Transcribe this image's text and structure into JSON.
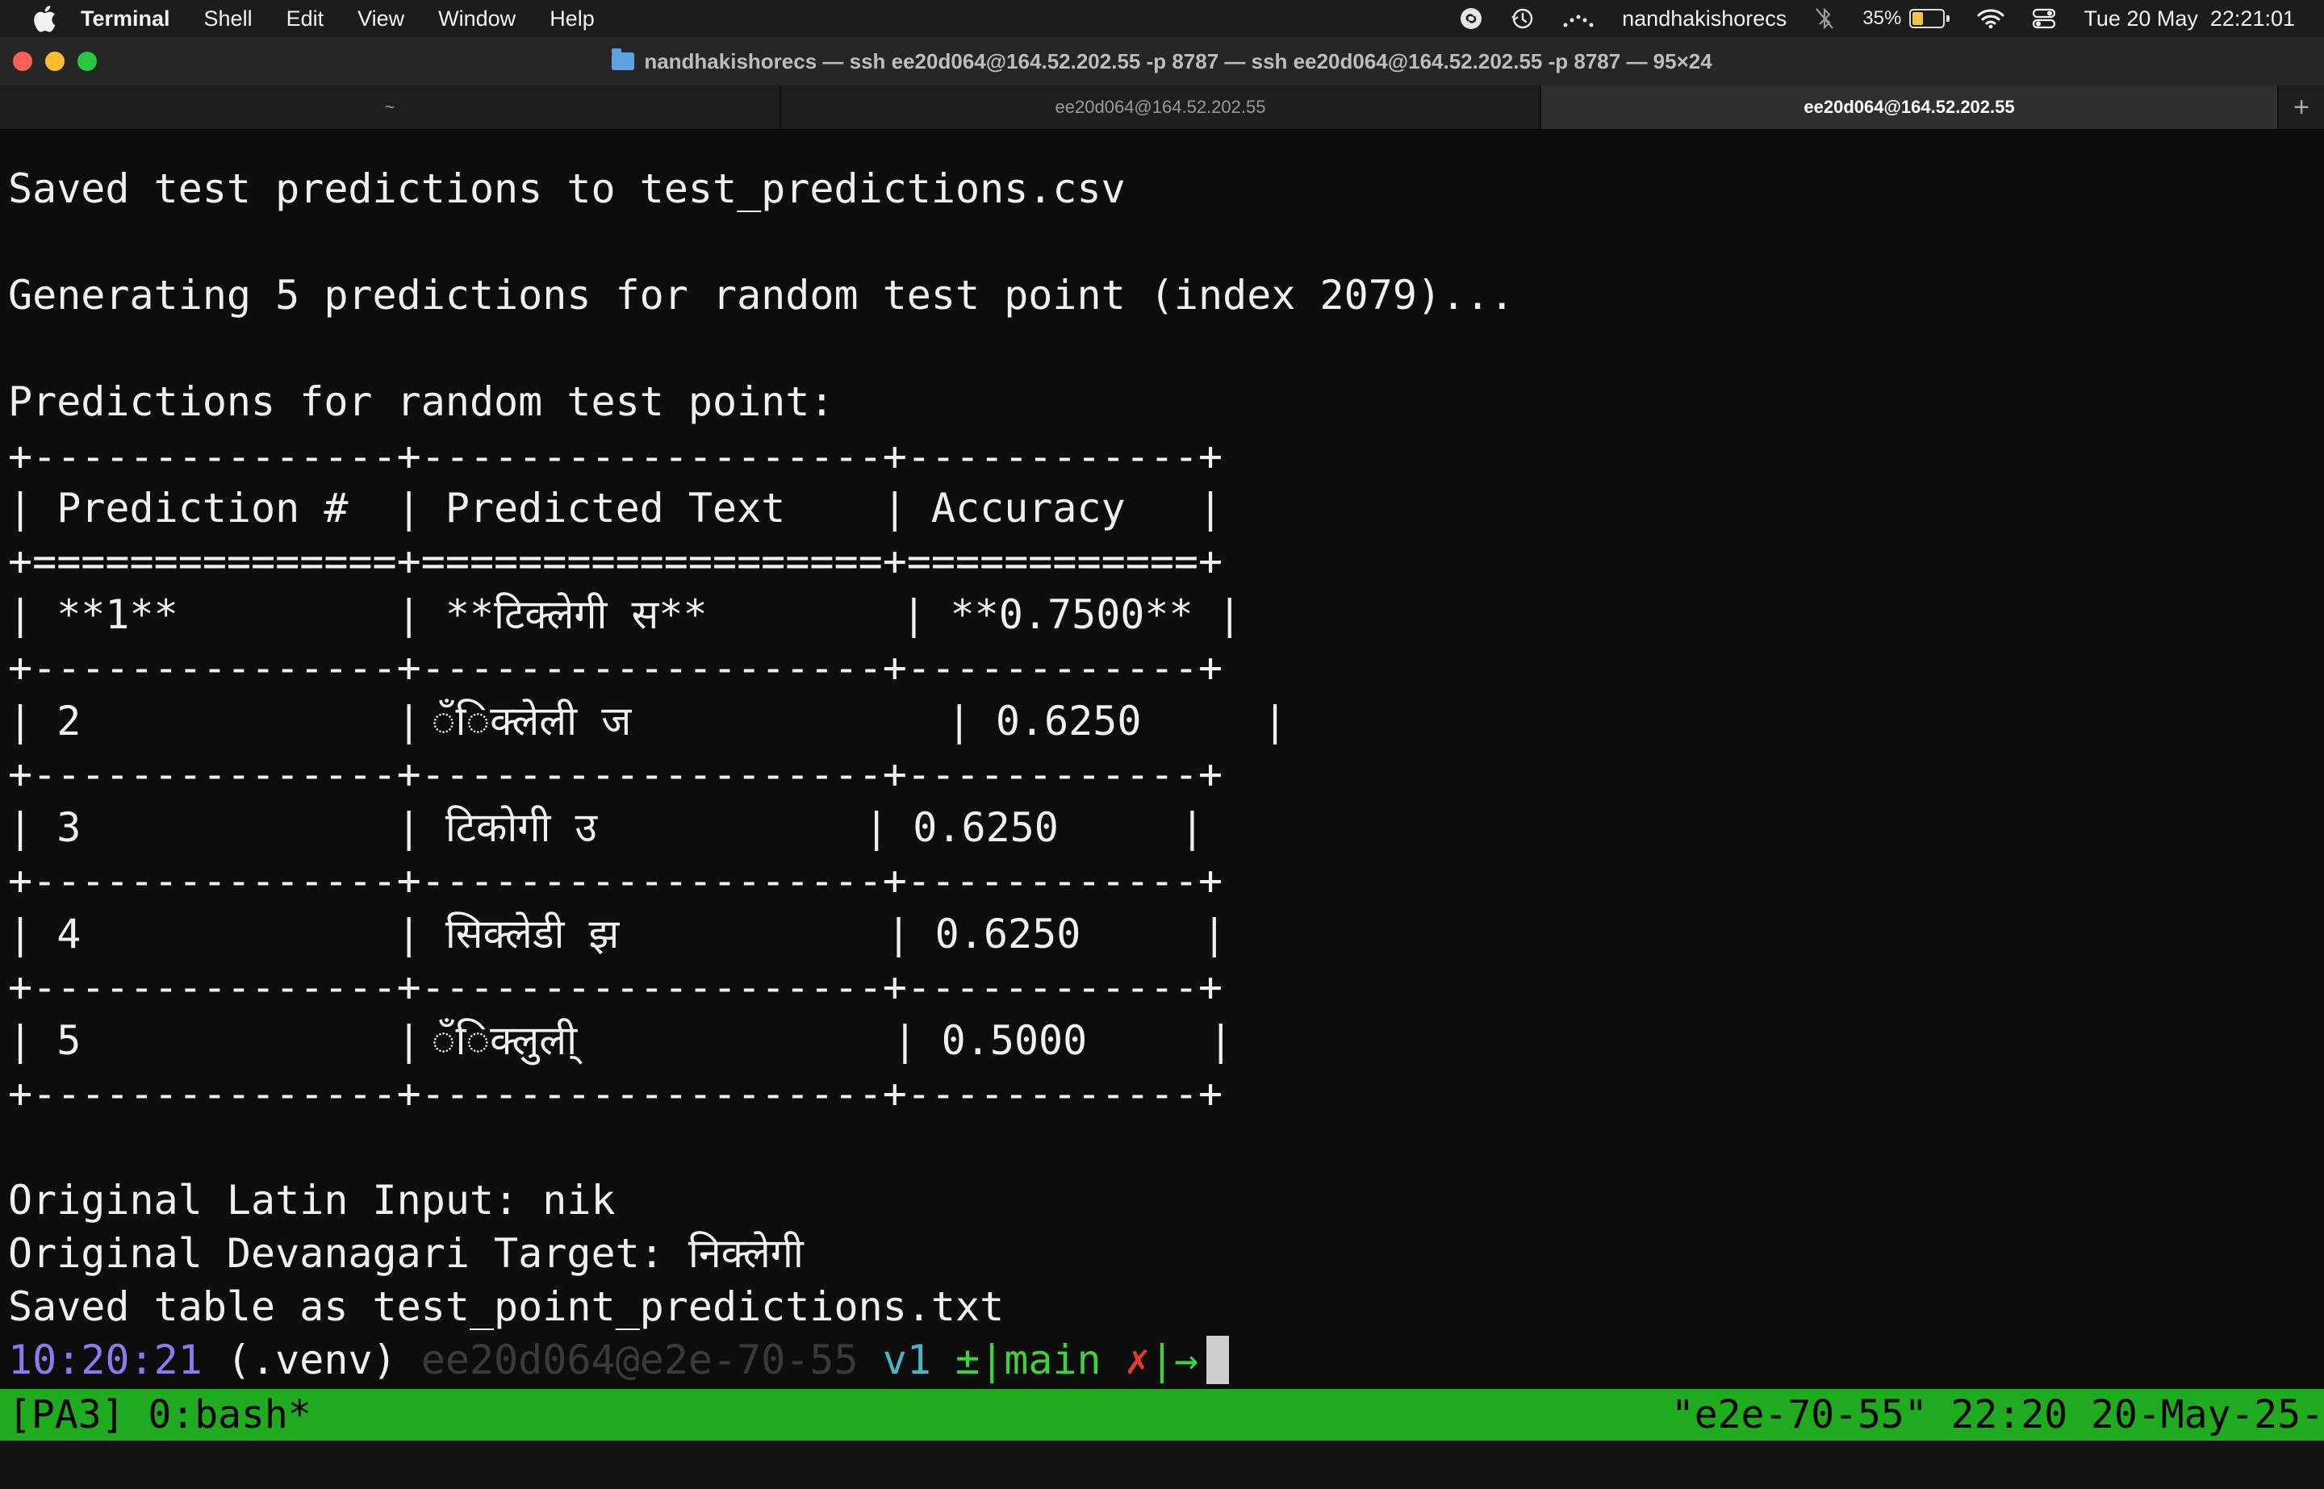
{
  "menubar": {
    "app_name": "Terminal",
    "items": [
      "Shell",
      "Edit",
      "View",
      "Window",
      "Help"
    ],
    "user": "nandhakishorecs",
    "battery_percent": "35%",
    "battery_level": 0.35,
    "datetime": "Tue 20 May  22:21:01"
  },
  "window": {
    "title": "nandhakishorecs — ssh ee20d064@164.52.202.55 -p 8787 — ssh ee20d064@164.52.202.55 -p 8787 — 95×24",
    "tabs": [
      {
        "label": "~"
      },
      {
        "label": "ee20d064@164.52.202.55"
      },
      {
        "label": "ee20d064@164.52.202.55"
      }
    ],
    "new_tab_symbol": "+"
  },
  "terminal": {
    "line_saved_predictions": "Saved test predictions to test_predictions.csv",
    "line_generating": "Generating 5 predictions for random test point (index 2079)...",
    "line_predictions_header": "Predictions for random test point:",
    "table": {
      "border": "+---------------+-------------------+------------+",
      "header_sep": "+===============+===================+============+",
      "header": "| Prediction #  | Predicted Text    | Accuracy   |",
      "rows": [
        "| **1**         | **टिक्लेगी स**        | **0.7500** |",
        "| 2             | ॅंिक्लेली ज             | 0.6250     |",
        "| 3             | टिकोगी उ           | 0.6250     |",
        "| 4             | सिक्लेडी झ           | 0.6250     |",
        "| 5             | ॅंिक्लुली्             | 0.5000     |"
      ]
    },
    "line_original_latin": "Original Latin Input: nik",
    "line_original_devanagari": "Original Devanagari Target: निक्लेगी",
    "line_saved_table": "Saved table as test_point_predictions.txt",
    "prompt": {
      "time": "10:20:21",
      "venv": " (.venv) ",
      "host": "ee20d064@e2e-70-55",
      "ver": " v1 ",
      "git": "±|main ",
      "x": "✗",
      "arrow": "|→"
    }
  },
  "tmux": {
    "left": "[PA3] 0:bash*",
    "right": "\"e2e-70-55\" 22:20 20-May-25-"
  },
  "colors": {
    "tmux_bg": "#1faa1f",
    "prompt_time": "#8a7bf0",
    "git_branch": "#3ed33a",
    "dirty_mark": "#e23b2b"
  }
}
